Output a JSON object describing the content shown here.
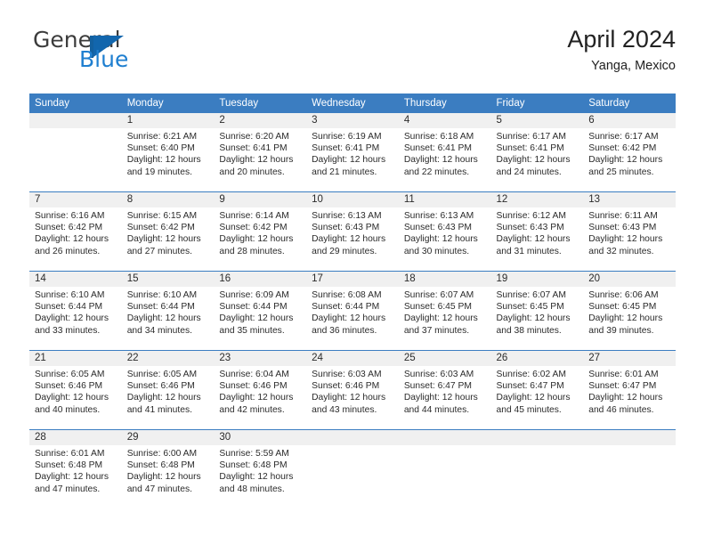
{
  "brand": {
    "name_part1": "General",
    "name_part2": "Blue",
    "logo_icon": "blue-flag-triangle-icon"
  },
  "header": {
    "title": "April 2024",
    "subtitle": "Yanga, Mexico"
  },
  "colors": {
    "header_blue": "#3b7dc1",
    "brand_blue": "#1f7fd0",
    "day_band_gray": "#f0f0f0",
    "text": "#2b2b2b"
  },
  "calendar": {
    "weekday_headers": [
      "Sunday",
      "Monday",
      "Tuesday",
      "Wednesday",
      "Thursday",
      "Friday",
      "Saturday"
    ],
    "weeks": [
      [
        {
          "day": "",
          "sunrise": "",
          "sunset": "",
          "daylight1": "",
          "daylight2": "",
          "empty": true
        },
        {
          "day": "1",
          "sunrise": "Sunrise: 6:21 AM",
          "sunset": "Sunset: 6:40 PM",
          "daylight1": "Daylight: 12 hours",
          "daylight2": "and 19 minutes."
        },
        {
          "day": "2",
          "sunrise": "Sunrise: 6:20 AM",
          "sunset": "Sunset: 6:41 PM",
          "daylight1": "Daylight: 12 hours",
          "daylight2": "and 20 minutes."
        },
        {
          "day": "3",
          "sunrise": "Sunrise: 6:19 AM",
          "sunset": "Sunset: 6:41 PM",
          "daylight1": "Daylight: 12 hours",
          "daylight2": "and 21 minutes."
        },
        {
          "day": "4",
          "sunrise": "Sunrise: 6:18 AM",
          "sunset": "Sunset: 6:41 PM",
          "daylight1": "Daylight: 12 hours",
          "daylight2": "and 22 minutes."
        },
        {
          "day": "5",
          "sunrise": "Sunrise: 6:17 AM",
          "sunset": "Sunset: 6:41 PM",
          "daylight1": "Daylight: 12 hours",
          "daylight2": "and 24 minutes."
        },
        {
          "day": "6",
          "sunrise": "Sunrise: 6:17 AM",
          "sunset": "Sunset: 6:42 PM",
          "daylight1": "Daylight: 12 hours",
          "daylight2": "and 25 minutes."
        }
      ],
      [
        {
          "day": "7",
          "sunrise": "Sunrise: 6:16 AM",
          "sunset": "Sunset: 6:42 PM",
          "daylight1": "Daylight: 12 hours",
          "daylight2": "and 26 minutes."
        },
        {
          "day": "8",
          "sunrise": "Sunrise: 6:15 AM",
          "sunset": "Sunset: 6:42 PM",
          "daylight1": "Daylight: 12 hours",
          "daylight2": "and 27 minutes."
        },
        {
          "day": "9",
          "sunrise": "Sunrise: 6:14 AM",
          "sunset": "Sunset: 6:42 PM",
          "daylight1": "Daylight: 12 hours",
          "daylight2": "and 28 minutes."
        },
        {
          "day": "10",
          "sunrise": "Sunrise: 6:13 AM",
          "sunset": "Sunset: 6:43 PM",
          "daylight1": "Daylight: 12 hours",
          "daylight2": "and 29 minutes."
        },
        {
          "day": "11",
          "sunrise": "Sunrise: 6:13 AM",
          "sunset": "Sunset: 6:43 PM",
          "daylight1": "Daylight: 12 hours",
          "daylight2": "and 30 minutes."
        },
        {
          "day": "12",
          "sunrise": "Sunrise: 6:12 AM",
          "sunset": "Sunset: 6:43 PM",
          "daylight1": "Daylight: 12 hours",
          "daylight2": "and 31 minutes."
        },
        {
          "day": "13",
          "sunrise": "Sunrise: 6:11 AM",
          "sunset": "Sunset: 6:43 PM",
          "daylight1": "Daylight: 12 hours",
          "daylight2": "and 32 minutes."
        }
      ],
      [
        {
          "day": "14",
          "sunrise": "Sunrise: 6:10 AM",
          "sunset": "Sunset: 6:44 PM",
          "daylight1": "Daylight: 12 hours",
          "daylight2": "and 33 minutes."
        },
        {
          "day": "15",
          "sunrise": "Sunrise: 6:10 AM",
          "sunset": "Sunset: 6:44 PM",
          "daylight1": "Daylight: 12 hours",
          "daylight2": "and 34 minutes."
        },
        {
          "day": "16",
          "sunrise": "Sunrise: 6:09 AM",
          "sunset": "Sunset: 6:44 PM",
          "daylight1": "Daylight: 12 hours",
          "daylight2": "and 35 minutes."
        },
        {
          "day": "17",
          "sunrise": "Sunrise: 6:08 AM",
          "sunset": "Sunset: 6:44 PM",
          "daylight1": "Daylight: 12 hours",
          "daylight2": "and 36 minutes."
        },
        {
          "day": "18",
          "sunrise": "Sunrise: 6:07 AM",
          "sunset": "Sunset: 6:45 PM",
          "daylight1": "Daylight: 12 hours",
          "daylight2": "and 37 minutes."
        },
        {
          "day": "19",
          "sunrise": "Sunrise: 6:07 AM",
          "sunset": "Sunset: 6:45 PM",
          "daylight1": "Daylight: 12 hours",
          "daylight2": "and 38 minutes."
        },
        {
          "day": "20",
          "sunrise": "Sunrise: 6:06 AM",
          "sunset": "Sunset: 6:45 PM",
          "daylight1": "Daylight: 12 hours",
          "daylight2": "and 39 minutes."
        }
      ],
      [
        {
          "day": "21",
          "sunrise": "Sunrise: 6:05 AM",
          "sunset": "Sunset: 6:46 PM",
          "daylight1": "Daylight: 12 hours",
          "daylight2": "and 40 minutes."
        },
        {
          "day": "22",
          "sunrise": "Sunrise: 6:05 AM",
          "sunset": "Sunset: 6:46 PM",
          "daylight1": "Daylight: 12 hours",
          "daylight2": "and 41 minutes."
        },
        {
          "day": "23",
          "sunrise": "Sunrise: 6:04 AM",
          "sunset": "Sunset: 6:46 PM",
          "daylight1": "Daylight: 12 hours",
          "daylight2": "and 42 minutes."
        },
        {
          "day": "24",
          "sunrise": "Sunrise: 6:03 AM",
          "sunset": "Sunset: 6:46 PM",
          "daylight1": "Daylight: 12 hours",
          "daylight2": "and 43 minutes."
        },
        {
          "day": "25",
          "sunrise": "Sunrise: 6:03 AM",
          "sunset": "Sunset: 6:47 PM",
          "daylight1": "Daylight: 12 hours",
          "daylight2": "and 44 minutes."
        },
        {
          "day": "26",
          "sunrise": "Sunrise: 6:02 AM",
          "sunset": "Sunset: 6:47 PM",
          "daylight1": "Daylight: 12 hours",
          "daylight2": "and 45 minutes."
        },
        {
          "day": "27",
          "sunrise": "Sunrise: 6:01 AM",
          "sunset": "Sunset: 6:47 PM",
          "daylight1": "Daylight: 12 hours",
          "daylight2": "and 46 minutes."
        }
      ],
      [
        {
          "day": "28",
          "sunrise": "Sunrise: 6:01 AM",
          "sunset": "Sunset: 6:48 PM",
          "daylight1": "Daylight: 12 hours",
          "daylight2": "and 47 minutes."
        },
        {
          "day": "29",
          "sunrise": "Sunrise: 6:00 AM",
          "sunset": "Sunset: 6:48 PM",
          "daylight1": "Daylight: 12 hours",
          "daylight2": "and 47 minutes."
        },
        {
          "day": "30",
          "sunrise": "Sunrise: 5:59 AM",
          "sunset": "Sunset: 6:48 PM",
          "daylight1": "Daylight: 12 hours",
          "daylight2": "and 48 minutes."
        },
        {
          "day": "",
          "sunrise": "",
          "sunset": "",
          "daylight1": "",
          "daylight2": "",
          "empty": true
        },
        {
          "day": "",
          "sunrise": "",
          "sunset": "",
          "daylight1": "",
          "daylight2": "",
          "empty": true
        },
        {
          "day": "",
          "sunrise": "",
          "sunset": "",
          "daylight1": "",
          "daylight2": "",
          "empty": true
        },
        {
          "day": "",
          "sunrise": "",
          "sunset": "",
          "daylight1": "",
          "daylight2": "",
          "empty": true
        }
      ]
    ]
  }
}
